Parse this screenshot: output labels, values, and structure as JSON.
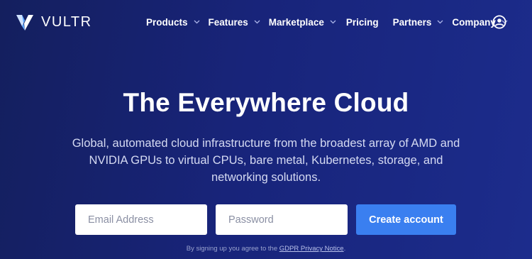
{
  "brand": {
    "name": "VULTR",
    "logo_icon": "vultr-v-logo"
  },
  "nav": {
    "items": [
      {
        "label": "Products",
        "has_dropdown": true
      },
      {
        "label": "Features",
        "has_dropdown": true
      },
      {
        "label": "Marketplace",
        "has_dropdown": true
      },
      {
        "label": "Pricing",
        "has_dropdown": false
      },
      {
        "label": "Partners",
        "has_dropdown": true
      },
      {
        "label": "Company",
        "has_dropdown": true
      }
    ],
    "account_icon": "user-circle-icon"
  },
  "hero": {
    "title": "The Everywhere Cloud",
    "subtitle": "Global, automated cloud infrastructure from the broadest array of AMD and NVIDIA GPUs to virtual CPUs, bare metal, Kubernetes, storage, and networking solutions."
  },
  "signup": {
    "email_placeholder": "Email Address",
    "password_placeholder": "Password",
    "submit_label": "Create account",
    "legal_prefix": "By signing up you agree to the ",
    "legal_link": "GDPR Privacy Notice",
    "legal_suffix": "."
  },
  "colors": {
    "background_start": "#141f5e",
    "background_end": "#1c2c8c",
    "button": "#3a7ff0",
    "logo_light": "#ffffff",
    "logo_accent": "#5aa7ff"
  }
}
